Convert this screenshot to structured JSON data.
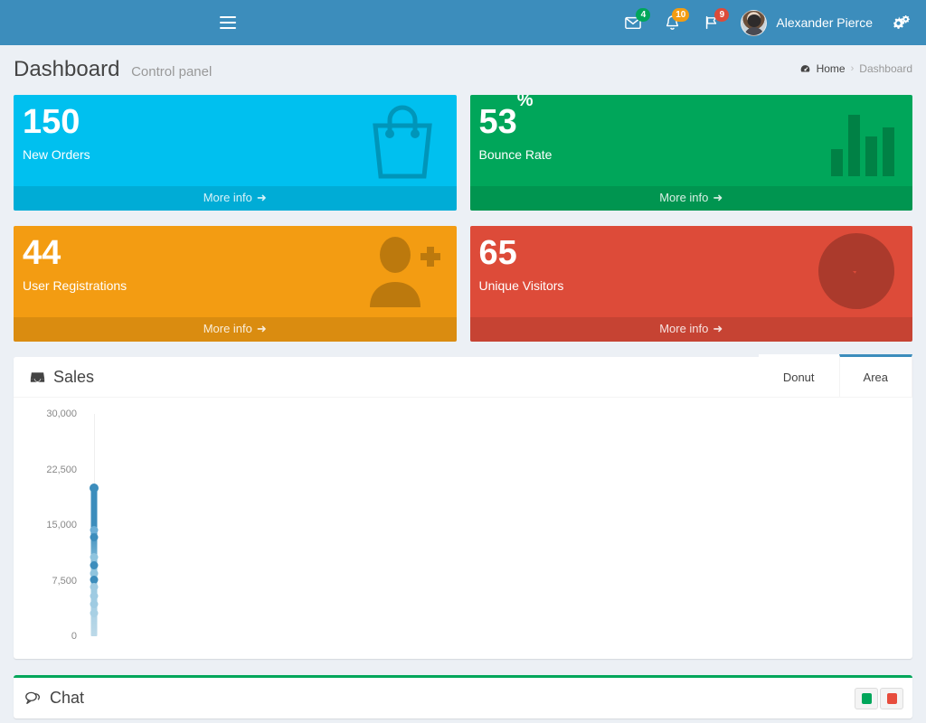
{
  "header": {
    "toggle_icon": "hamburger-icon",
    "messages": {
      "icon": "envelope-icon",
      "count": "4",
      "color": "#00a65a"
    },
    "notifications": {
      "icon": "bell-icon",
      "count": "10",
      "color": "#f39c12"
    },
    "tasks": {
      "icon": "flag-icon",
      "count": "9",
      "color": "#dd4b39"
    },
    "user": {
      "name": "Alexander Pierce",
      "avatar": "user-avatar"
    },
    "settings_icon": "gears-icon",
    "bg_color": "#3c8dbc"
  },
  "page": {
    "title": "Dashboard",
    "subtitle": "Control panel"
  },
  "breadcrumb": {
    "home_icon": "dashboard-icon",
    "home": "Home",
    "separator": "›",
    "current": "Dashboard"
  },
  "boxes": [
    {
      "value": "150",
      "suffix": "",
      "label": "New Orders",
      "footer": "More info",
      "icon": "shopping-bag-icon",
      "color": "#00c0ef",
      "class": "bg-aqua"
    },
    {
      "value": "53",
      "suffix": "%",
      "label": "Bounce Rate",
      "footer": "More info",
      "icon": "bar-chart-icon",
      "color": "#00a65a",
      "class": "bg-green"
    },
    {
      "value": "44",
      "suffix": "",
      "label": "User Registrations",
      "footer": "More info",
      "icon": "user-plus-icon",
      "color": "#f39c12",
      "class": "bg-yellow"
    },
    {
      "value": "65",
      "suffix": "",
      "label": "Unique Visitors",
      "footer": "More info",
      "icon": "pie-chart-icon",
      "color": "#dd4b39",
      "class": "bg-red"
    }
  ],
  "sales": {
    "title": "Sales",
    "icon": "inbox-icon",
    "tabs": [
      {
        "label": "Donut",
        "active": false
      },
      {
        "label": "Area",
        "active": true
      }
    ]
  },
  "chart_data": {
    "type": "area",
    "title": "Sales",
    "xlabel": "",
    "ylabel": "",
    "ylim": [
      0,
      30000
    ],
    "yticks": [
      0,
      7500,
      15000,
      22500,
      30000
    ],
    "ytick_labels": [
      "0",
      "7,500",
      "15,000",
      "22,500",
      "30,000"
    ],
    "grid": false,
    "legend_position": "none",
    "note": "Area chart rendered collapsed to a single x position; all series points stack vertically at the axis origin.",
    "x": [
      0
    ],
    "series": [
      {
        "name": "series-1",
        "color": "#3c8dbc",
        "values": [
          20000
        ]
      },
      {
        "name": "series-2",
        "color": "#6aaed6",
        "values": [
          14300
        ]
      },
      {
        "name": "series-3",
        "color": "#3c8dbc",
        "values": [
          13400
        ]
      },
      {
        "name": "series-4",
        "color": "#8fc4de",
        "values": [
          10700
        ]
      },
      {
        "name": "series-5",
        "color": "#3c8dbc",
        "values": [
          9600
        ]
      },
      {
        "name": "series-6",
        "color": "#8fc4de",
        "values": [
          8500
        ]
      },
      {
        "name": "series-7",
        "color": "#3c8dbc",
        "values": [
          7600
        ]
      },
      {
        "name": "series-8",
        "color": "#9fcbe2",
        "values": [
          6600
        ]
      },
      {
        "name": "series-9",
        "color": "#9fcbe2",
        "values": [
          5400
        ]
      },
      {
        "name": "series-10",
        "color": "#9fcbe2",
        "values": [
          4300
        ]
      },
      {
        "name": "series-11",
        "color": "#a8d0e4",
        "values": [
          3100
        ]
      }
    ]
  },
  "chat": {
    "title": "Chat",
    "icon": "comments-icon",
    "tools": [
      {
        "name": "status-online-button",
        "color": "#00a65a"
      },
      {
        "name": "status-offline-button",
        "color": "#e74c3c"
      }
    ],
    "accent_color": "#00a65a"
  }
}
